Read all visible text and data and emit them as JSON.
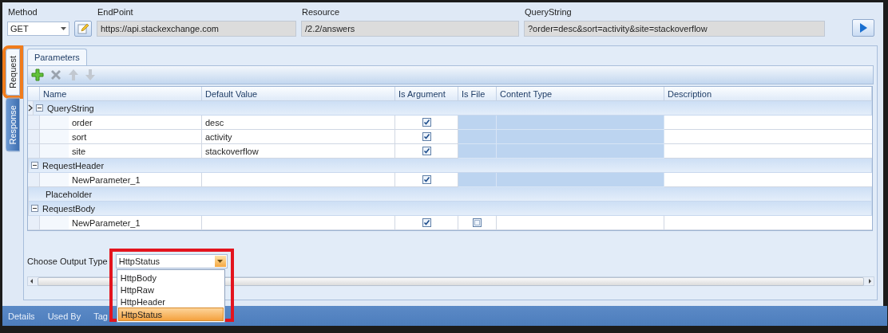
{
  "request_bar": {
    "method": {
      "label": "Method",
      "value": "GET"
    },
    "endpoint": {
      "label": "EndPoint",
      "value": "https://api.stackexchange.com"
    },
    "resource": {
      "label": "Resource",
      "value": "/2.2/answers"
    },
    "query_string": {
      "label": "QueryString",
      "value": "?order=desc&sort=activity&site=stackoverflow"
    }
  },
  "side_tabs": [
    {
      "label": "Request",
      "selected": true,
      "highlighted": true
    },
    {
      "label": "Response",
      "selected": false,
      "highlighted": false
    }
  ],
  "inner_tabs": [
    {
      "label": "Parameters",
      "selected": true
    }
  ],
  "toolbar": [
    {
      "kind": "add",
      "disabled": false
    },
    {
      "kind": "delete",
      "disabled": true
    },
    {
      "kind": "up",
      "disabled": true
    },
    {
      "kind": "down",
      "disabled": true
    }
  ],
  "table": {
    "columns": [
      "Name",
      "Default Value",
      "Is Argument",
      "Is File",
      "Content Type",
      "Description"
    ],
    "groups": [
      {
        "name": "QueryString",
        "expanded": true,
        "current": true,
        "children": [
          {
            "name": "order",
            "default_value": "desc",
            "is_argument": true,
            "file_disabled": true
          },
          {
            "name": "sort",
            "default_value": "activity",
            "is_argument": true,
            "file_disabled": true
          },
          {
            "name": "site",
            "default_value": "stackoverflow",
            "is_argument": true,
            "file_disabled": true
          }
        ]
      },
      {
        "name": "RequestHeader",
        "expanded": true,
        "current": false,
        "children": [
          {
            "name": "NewParameter_1",
            "is_argument": true,
            "file_disabled": true
          }
        ]
      },
      {
        "name": "Placeholder",
        "current": false
      },
      {
        "name": "RequestBody",
        "expanded": true,
        "current": false,
        "children": [
          {
            "name": "NewParameter_1",
            "is_argument": true,
            "file_disabled": false,
            "is_file": false
          }
        ]
      }
    ]
  },
  "output_type": {
    "label": "Choose Output Type",
    "value": "HttpStatus",
    "highlighted": true,
    "open": true,
    "options": [
      {
        "label": "HttpBody",
        "selected": false
      },
      {
        "label": "HttpRaw",
        "selected": false
      },
      {
        "label": "HttpHeader",
        "selected": false
      },
      {
        "label": "HttpStatus",
        "selected": true
      }
    ]
  },
  "bottom_tabs": [
    "Details",
    "Used By",
    "Tag"
  ]
}
